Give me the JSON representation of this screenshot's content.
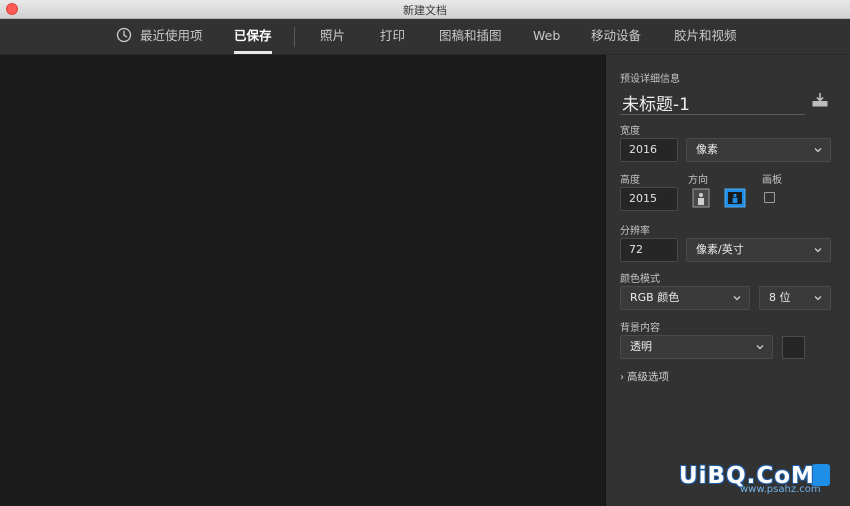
{
  "window": {
    "title": "新建文档"
  },
  "tabs": [
    {
      "label": "最近使用项"
    },
    {
      "label": "已保存"
    },
    {
      "label": "照片"
    },
    {
      "label": "打印"
    },
    {
      "label": "图稿和插图"
    },
    {
      "label": "Web"
    },
    {
      "label": "移动设备"
    },
    {
      "label": "胶片和视频"
    }
  ],
  "active_tab": "已保存",
  "panel": {
    "section_title": "预设详细信息",
    "doc_name": "未标题-1",
    "width": {
      "label": "宽度",
      "value": "2016",
      "unit": "像素"
    },
    "height": {
      "label": "高度",
      "value": "2015"
    },
    "orientation": {
      "label": "方向",
      "selected": "landscape"
    },
    "artboard": {
      "label": "画板",
      "checked": false
    },
    "resolution": {
      "label": "分辨率",
      "value": "72",
      "unit": "像素/英寸"
    },
    "color_mode": {
      "label": "颜色模式",
      "mode": "RGB 颜色",
      "depth": "8 位"
    },
    "background": {
      "label": "背景内容",
      "value": "透明"
    },
    "advanced": "高级选项"
  },
  "watermark": {
    "main": "UiBQ.CoM",
    "sub": "www.psahz.com"
  },
  "colors": {
    "accent": "#1f8ee6",
    "panel": "#323232",
    "canvas": "#1b1b1b"
  }
}
